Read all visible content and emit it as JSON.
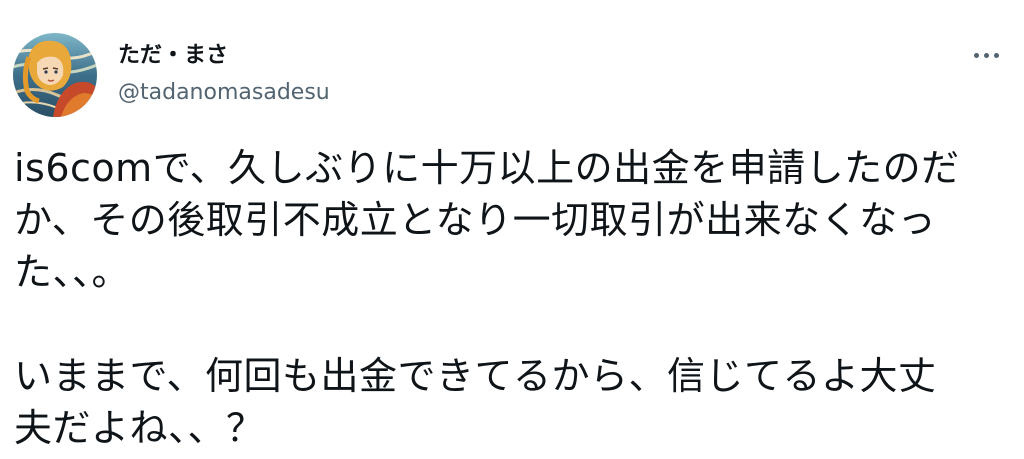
{
  "tweet": {
    "author": {
      "display_name": "ただ・まさ",
      "handle": "@tadanomasadesu",
      "avatar_icon": "avatar-illustration-icon"
    },
    "more_icon": "more-options-icon",
    "body": {
      "paragraphs": [
        {
          "lines": [
            "is6comで、久しぶりに十万以上の出金を申請したのだ",
            "か、その後取引不成立となり一切取引が出来なくなっ",
            "た、、。"
          ]
        },
        {
          "lines": [
            "いままで、何回も出金できてるから、信じてるよ大丈",
            "夫だよね、、？"
          ]
        }
      ]
    }
  },
  "colors": {
    "text_primary": "#0f1419",
    "text_secondary": "#536471",
    "background": "#ffffff"
  }
}
